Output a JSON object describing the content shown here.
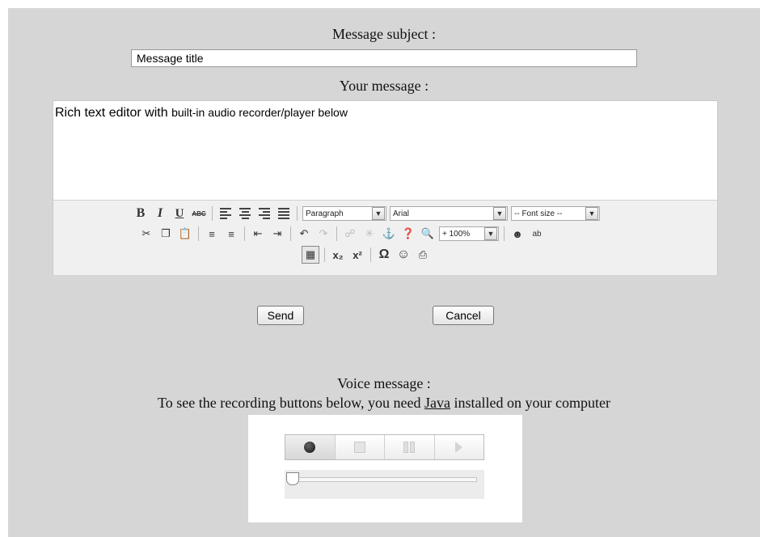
{
  "subject": {
    "label": "Message subject :",
    "value": "Message title"
  },
  "message": {
    "label": "Your message :",
    "text_large": "Rich text editor with ",
    "text_small": "built-in audio recorder/player below"
  },
  "toolbar": {
    "bold": "B",
    "italic": "I",
    "underline": "U",
    "strikethrough": "ABC",
    "format_select": "Paragraph",
    "font_select": "Arial",
    "size_select": "-- Font size --",
    "zoom_select": "+ 100%",
    "spell_check": "ab",
    "subscript": "x₂",
    "superscript": "x²",
    "special_char": "Ω",
    "icons": [
      "cut-icon",
      "copy-icon",
      "paste-icon",
      "bullet-list-icon",
      "numbered-list-icon",
      "outdent-icon",
      "indent-icon",
      "undo-icon",
      "redo-icon",
      "link-icon",
      "unlink-icon",
      "anchor-icon",
      "help-icon",
      "preview-icon",
      "emotions-icon",
      "table-icon",
      "emoticon-icon",
      "print-icon"
    ]
  },
  "buttons": {
    "send": "Send",
    "cancel": "Cancel"
  },
  "voice": {
    "title": "Voice message :",
    "note_before": "To see the recording buttons below, you need ",
    "note_link": "Java",
    "note_after": " installed on your computer",
    "position_fraction": 0
  }
}
